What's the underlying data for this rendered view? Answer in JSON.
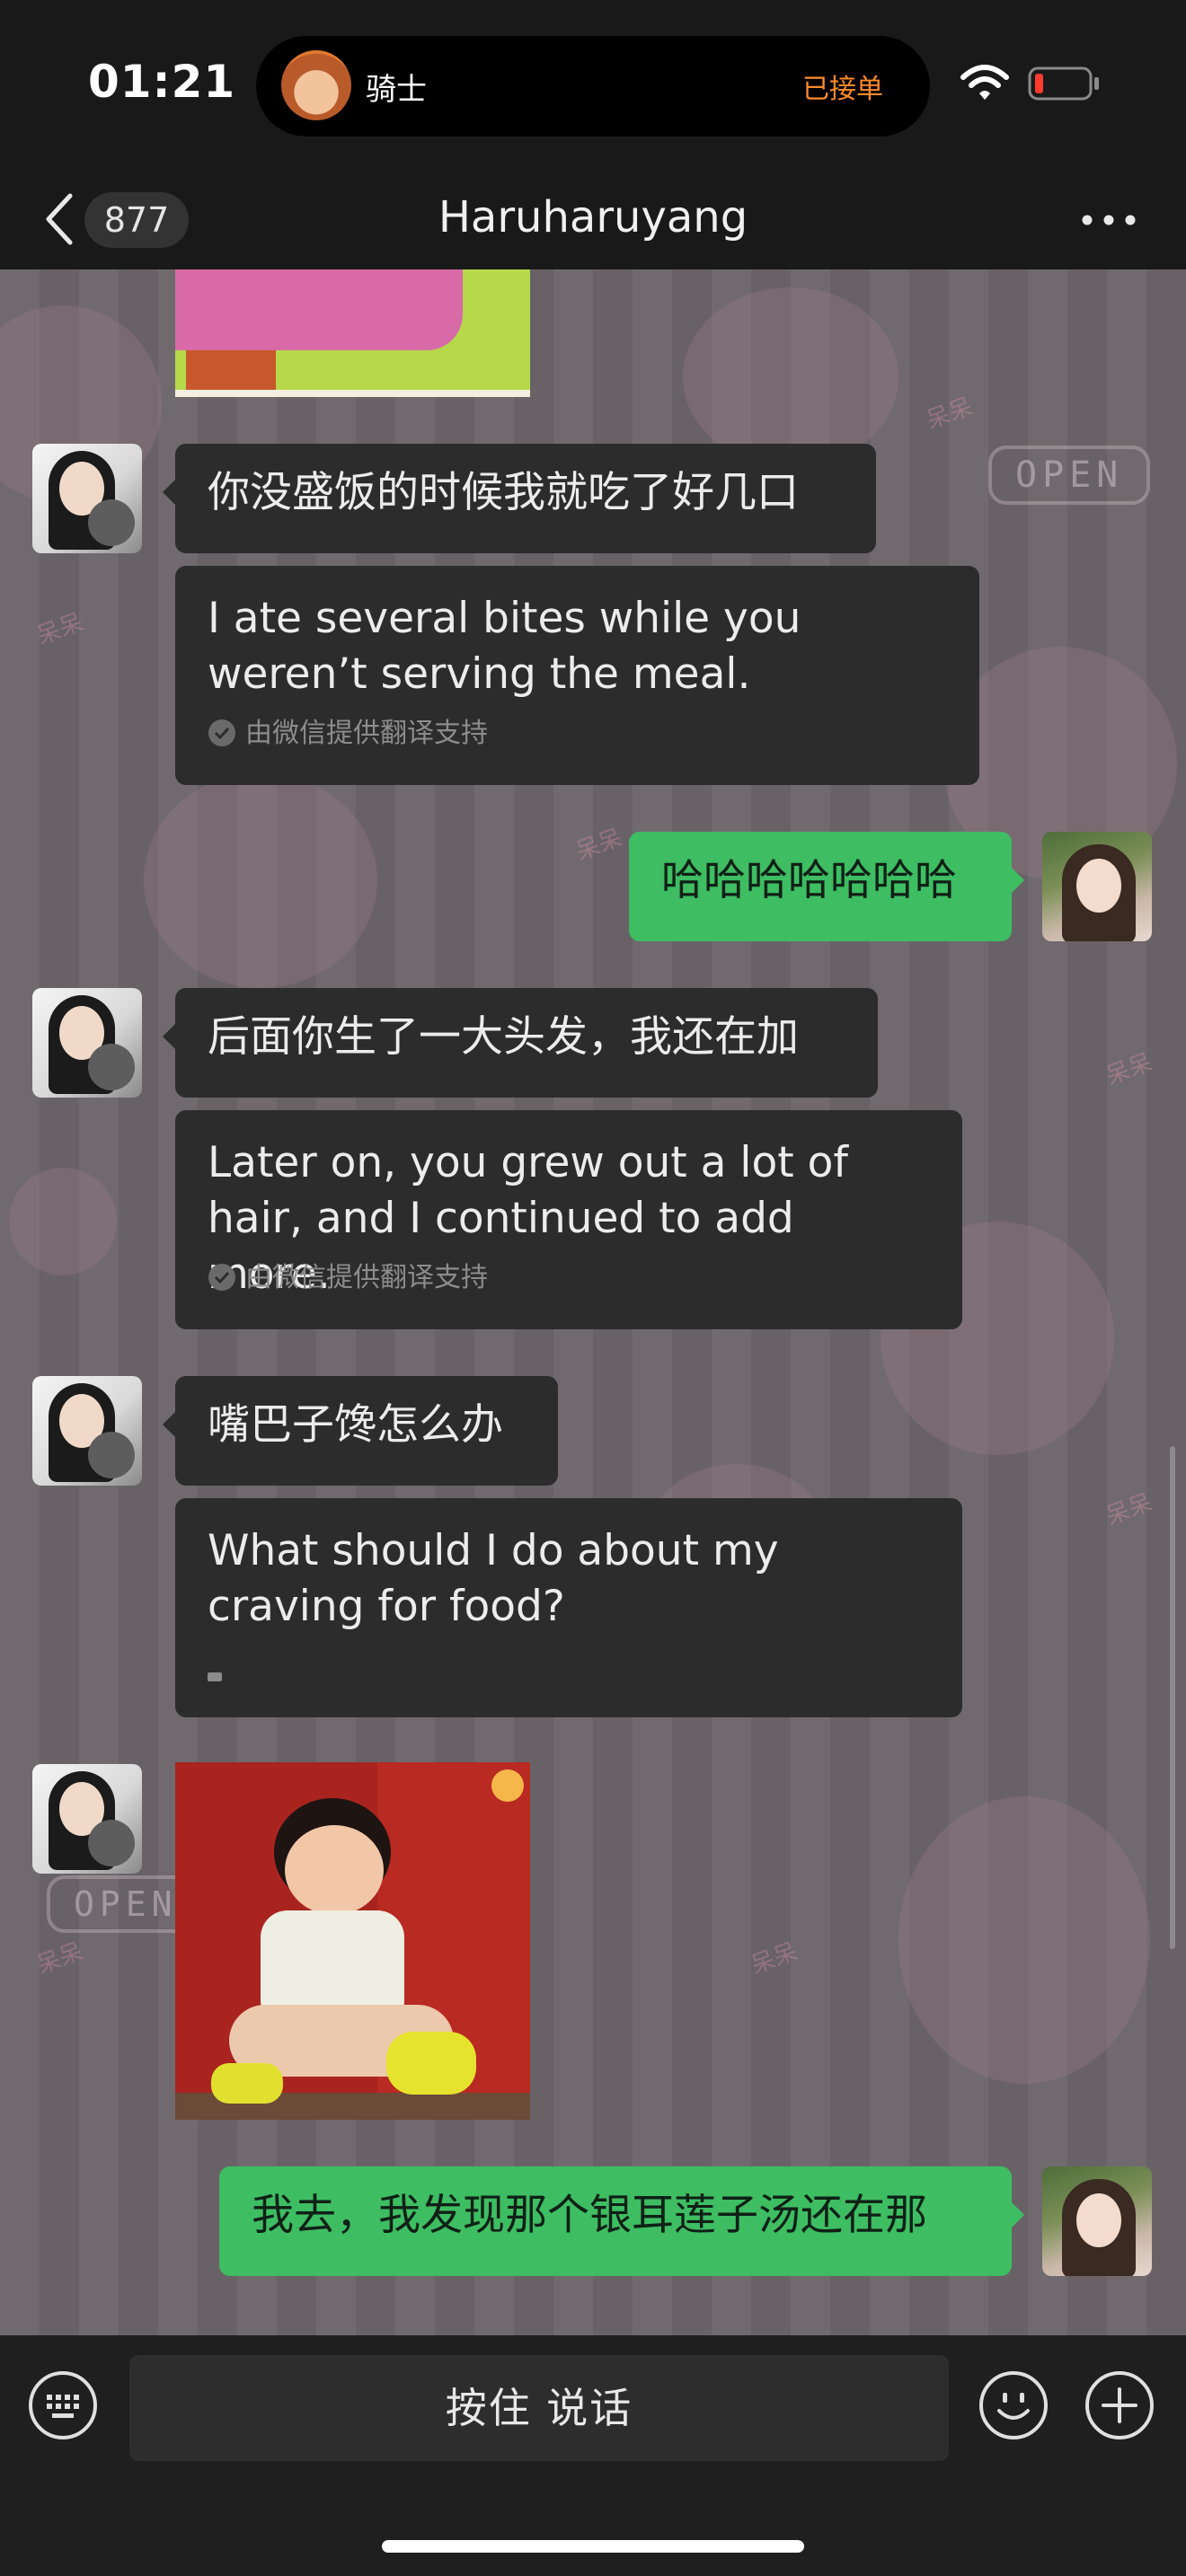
{
  "status_bar": {
    "time": "01:21",
    "island_label": "骑士",
    "island_status": "已接单",
    "battery_color": "#ff3b30"
  },
  "nav": {
    "unread_count": "877",
    "title": "Haruharuyang"
  },
  "messages": [
    {
      "side": "left",
      "type": "text",
      "text": "你没盛饭的时候我就吃了好几口",
      "translation": "I ate several bites while you weren’t serving the meal.",
      "translation_source": "由微信提供翻译支持"
    },
    {
      "side": "right",
      "type": "text",
      "text": "哈哈哈哈哈哈哈"
    },
    {
      "side": "left",
      "type": "text",
      "text": "后面你生了一大头发，我还在加",
      "translation": "Later on, you grew out a lot of hair, and I continued to add more.",
      "translation_source": "由微信提供翻译支持"
    },
    {
      "side": "left",
      "type": "text",
      "text": "嘴巴子馋怎么办",
      "translation": "What should I do about my craving for food?",
      "translation_loading": true
    },
    {
      "side": "left",
      "type": "image",
      "image": "crying-child-sticker"
    },
    {
      "side": "right",
      "type": "text",
      "text": "我去，我发现那个银耳莲子汤还在那"
    }
  ],
  "background": {
    "watermark_text": "呆呆",
    "sign_text": "OPEN"
  },
  "input_bar": {
    "voice_label": "按住 说话",
    "left_icon": "keyboard-icon",
    "emoji_icon": "emoji-icon",
    "plus_icon": "plus-icon"
  },
  "colors": {
    "accent_green": "#3ebd62",
    "bubble_dark": "#2c2c2c",
    "island_status": "#ff8a2a"
  }
}
